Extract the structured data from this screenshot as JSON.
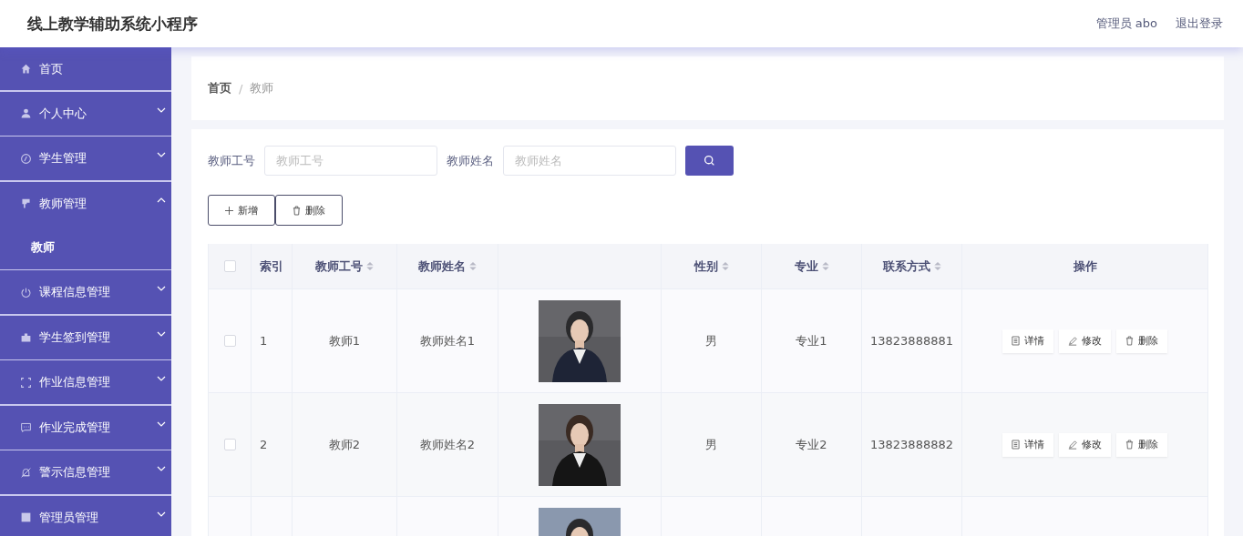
{
  "header": {
    "title": "线上教学辅助系统小程序",
    "user": "管理员 abo",
    "logout": "退出登录"
  },
  "sidebar": {
    "items": [
      {
        "label": "首页"
      },
      {
        "label": "个人中心",
        "expanded": false
      },
      {
        "label": "学生管理",
        "expanded": false
      },
      {
        "label": "教师管理",
        "expanded": true,
        "children": [
          {
            "label": "教师",
            "selected": true
          }
        ]
      },
      {
        "label": "课程信息管理",
        "expanded": false
      },
      {
        "label": "学生签到管理",
        "expanded": false
      },
      {
        "label": "作业信息管理",
        "expanded": false
      },
      {
        "label": "作业完成管理",
        "expanded": false
      },
      {
        "label": "警示信息管理",
        "expanded": false
      },
      {
        "label": "管理员管理",
        "expanded": false
      }
    ]
  },
  "breadcrumb": {
    "items": [
      "首页",
      "教师"
    ],
    "separator": "/"
  },
  "search": [
    {
      "label": "教师工号",
      "placeholder": "教师工号"
    },
    {
      "label": "教师姓名",
      "placeholder": "教师姓名"
    }
  ],
  "actions": [
    {
      "label": "新增",
      "kind": "add"
    },
    {
      "label": "删除",
      "kind": "delete"
    }
  ],
  "table": {
    "all_checked": false,
    "columns": [
      {
        "label": "索引",
        "sortable": false
      },
      {
        "label": "教师工号",
        "sortable": true
      },
      {
        "label": "教师姓名",
        "sortable": true
      },
      {
        "sortable": false
      },
      {
        "label": "性别",
        "sortable": true
      },
      {
        "label": "专业",
        "sortable": true
      },
      {
        "label": "联系方式",
        "sortable": true
      },
      {
        "label": "操作",
        "sortable": false
      }
    ],
    "rows": [
      {
        "checked": false,
        "cells": [
          "1",
          "教师1",
          "教师姓名1",
          null,
          "男",
          "专业1",
          "13823888881"
        ],
        "photo": {
          "kind": "picture"
        },
        "actions": [
          {
            "label": "详情",
            "kind": "detail"
          },
          {
            "label": "修改",
            "kind": "edit"
          },
          {
            "label": "删除",
            "kind": "delete"
          }
        ]
      },
      {
        "checked": false,
        "cells": [
          "2",
          "教师2",
          "教师姓名2",
          null,
          "男",
          "专业2",
          "13823888882"
        ],
        "photo": {
          "kind": "picture"
        },
        "actions": [
          {
            "label": "详情",
            "kind": "detail"
          },
          {
            "label": "修改",
            "kind": "edit"
          },
          {
            "label": "删除",
            "kind": "delete"
          }
        ]
      },
      {
        "photo": {
          "kind": "picture"
        }
      }
    ]
  }
}
